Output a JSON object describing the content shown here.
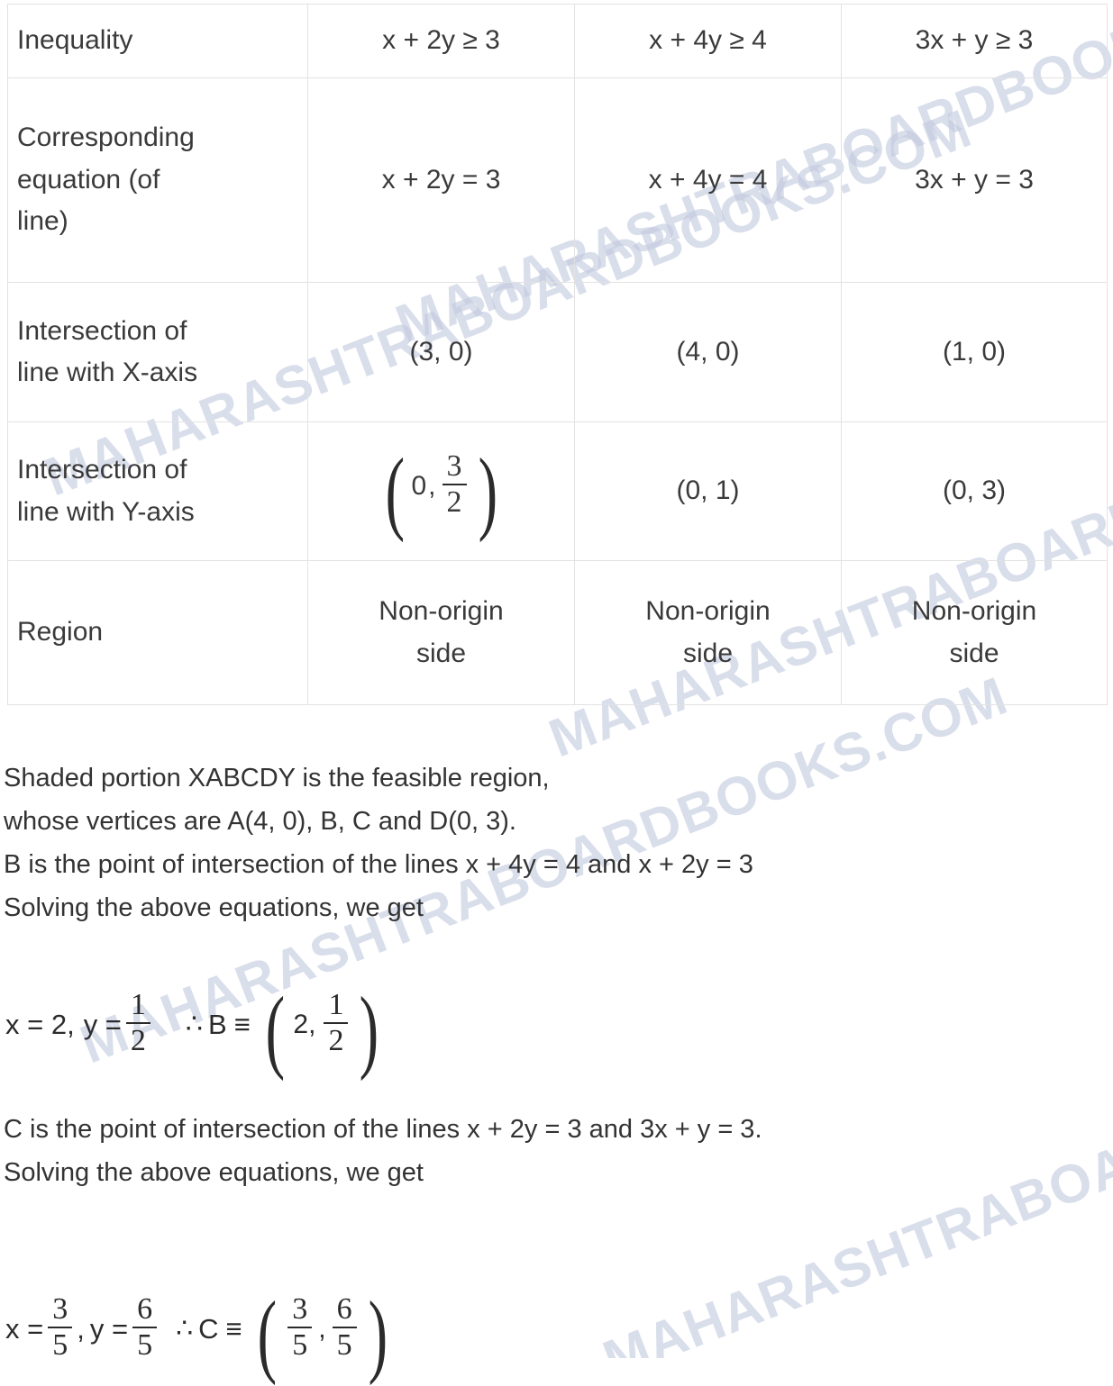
{
  "watermark": {
    "text": "MAHARASHTRABOARDBOOKS.COM",
    "color": "#c3cadf",
    "angle_deg": -21
  },
  "table": {
    "columns": [
      "",
      "col1",
      "col2",
      "col3"
    ],
    "rows": [
      {
        "label": "Inequality",
        "values": [
          "x + 2y ≥ 3",
          "x + 4y ≥ 4",
          "3x + y ≥ 3"
        ]
      },
      {
        "label_line1": "Corresponding",
        "label_line2": "equation (of",
        "label_line3": "line)",
        "values": [
          "x + 2y = 3",
          "x + 4y = 4",
          "3x + y = 3"
        ]
      },
      {
        "label_line1": "Intersection of",
        "label_line2": "line with X-axis",
        "values": [
          "(3, 0)",
          "(4, 0)",
          "(1, 0)"
        ]
      },
      {
        "label_line1": "Intersection of",
        "label_line2": "line with Y-axis",
        "value1": {
          "x": "0",
          "num": "3",
          "den": "2"
        },
        "values": [
          "(0, 1)",
          "(0, 3)"
        ]
      },
      {
        "label": "Region",
        "values_line1": [
          "Non-origin",
          "Non-origin",
          "Non-origin"
        ],
        "values_line2": [
          "side",
          "side",
          "side"
        ]
      }
    ]
  },
  "body": {
    "line1": "Shaded portion XABCDY is the feasible region,",
    "line2": "whose vertices are A(4, 0), B, C and D(0, 3).",
    "line3": "B is the point of intersection of the lines x + 4y = 4 and x + 2y = 3",
    "line4": "Solving the above equations, we get",
    "line5": "C is the point of intersection of the lines x + 2y = 3 and 3x + y = 3.",
    "line6": "Solving the above equations, we get"
  },
  "equation_b": {
    "x_label": "x = 2,",
    "y_label": "y =",
    "y_num": "1",
    "y_den": "2",
    "therefore": "∴",
    "point_label": "B",
    "equiv": "≡",
    "point_x": "2,",
    "point_num": "1",
    "point_den": "2"
  },
  "equation_c": {
    "x_label": "x =",
    "x_num": "3",
    "x_den": "5",
    "comma": ",",
    "y_label": "y =",
    "y_num": "6",
    "y_den": "5",
    "therefore": "∴",
    "point_label": "C",
    "equiv": "≡",
    "point_x_num": "3",
    "point_x_den": "5",
    "point_comma": ",",
    "point_y_num": "6",
    "point_y_den": "5"
  }
}
